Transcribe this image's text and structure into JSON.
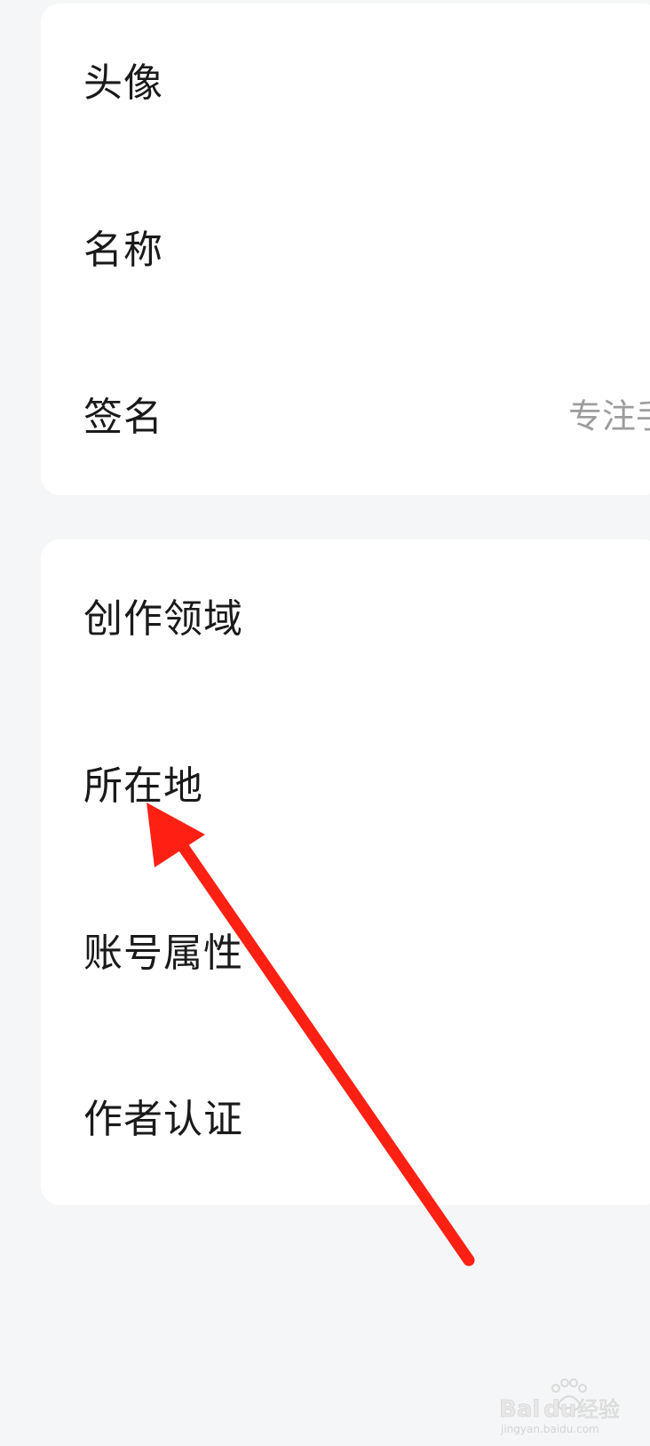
{
  "profile_card": {
    "rows": [
      {
        "label": "头像"
      },
      {
        "label": "名称"
      },
      {
        "label": "签名",
        "value": "专注手"
      }
    ]
  },
  "detail_card": {
    "rows": [
      {
        "label": "创作领域"
      },
      {
        "label": "所在地"
      },
      {
        "label": "账号属性"
      },
      {
        "label": "作者认证"
      }
    ]
  },
  "annotation": {
    "arrow_color": "#ff2014"
  },
  "watermark": {
    "brand": "Baidu经验",
    "url": "jingyan.baidu.com"
  }
}
